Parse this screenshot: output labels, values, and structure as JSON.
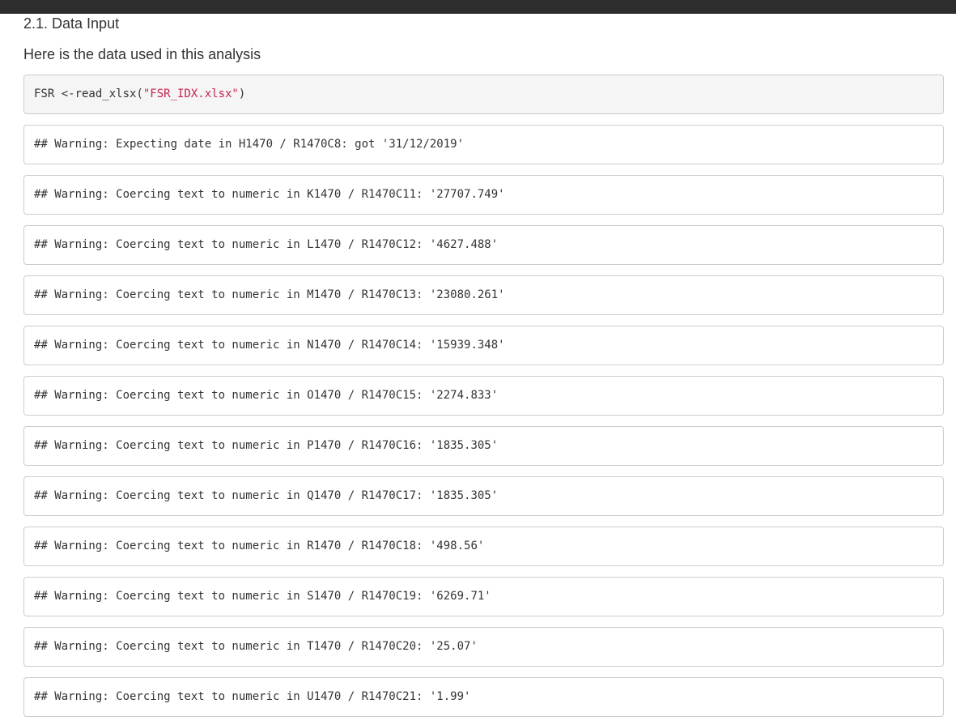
{
  "section": {
    "heading": "2.1. Data Input",
    "intro": "Here is the data used in this analysis"
  },
  "code": {
    "prefix": "FSR <-read_xlsx(",
    "string": "\"FSR_IDX.xlsx\"",
    "suffix": ")"
  },
  "outputs": [
    "## Warning: Expecting date in H1470 / R1470C8: got '31/12/2019'",
    "## Warning: Coercing text to numeric in K1470 / R1470C11: '27707.749'",
    "## Warning: Coercing text to numeric in L1470 / R1470C12: '4627.488'",
    "## Warning: Coercing text to numeric in M1470 / R1470C13: '23080.261'",
    "## Warning: Coercing text to numeric in N1470 / R1470C14: '15939.348'",
    "## Warning: Coercing text to numeric in O1470 / R1470C15: '2274.833'",
    "## Warning: Coercing text to numeric in P1470 / R1470C16: '1835.305'",
    "## Warning: Coercing text to numeric in Q1470 / R1470C17: '1835.305'",
    "## Warning: Coercing text to numeric in R1470 / R1470C18: '498.56'",
    "## Warning: Coercing text to numeric in S1470 / R1470C19: '6269.71'",
    "## Warning: Coercing text to numeric in T1470 / R1470C20: '25.07'",
    "## Warning: Coercing text to numeric in U1470 / R1470C21: '1.99'"
  ]
}
